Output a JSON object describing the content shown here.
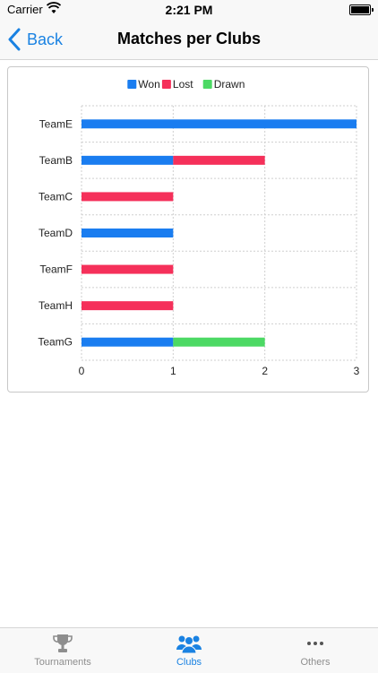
{
  "status_bar": {
    "carrier": "Carrier",
    "time": "2:21 PM"
  },
  "nav": {
    "back_label": "Back",
    "title": "Matches per Clubs"
  },
  "colors": {
    "won": "#1a7df0",
    "lost": "#f5305a",
    "drawn": "#4cd964",
    "accent": "#1a82e2"
  },
  "chart_data": {
    "type": "bar",
    "orientation": "horizontal",
    "stacked": true,
    "categories": [
      "TeamE",
      "TeamB",
      "TeamC",
      "TeamD",
      "TeamF",
      "TeamH",
      "TeamG"
    ],
    "series": [
      {
        "name": "Won",
        "color": "#1a7df0",
        "values": [
          3,
          1,
          0,
          1,
          0,
          0,
          1
        ]
      },
      {
        "name": "Lost",
        "color": "#f5305a",
        "values": [
          0,
          1,
          1,
          0,
          1,
          1,
          0
        ]
      },
      {
        "name": "Drawn",
        "color": "#4cd964",
        "values": [
          0,
          0,
          0,
          0,
          0,
          0,
          1
        ]
      }
    ],
    "xticks": [
      "0",
      "1",
      "2",
      "3"
    ],
    "xlim": [
      0,
      3
    ],
    "grid": true,
    "legend_position": "top"
  },
  "tabs": [
    {
      "label": "Tournaments",
      "icon": "trophy-icon",
      "active": false
    },
    {
      "label": "Clubs",
      "icon": "people-icon",
      "active": true
    },
    {
      "label": "Others",
      "icon": "more-icon",
      "active": false
    }
  ]
}
